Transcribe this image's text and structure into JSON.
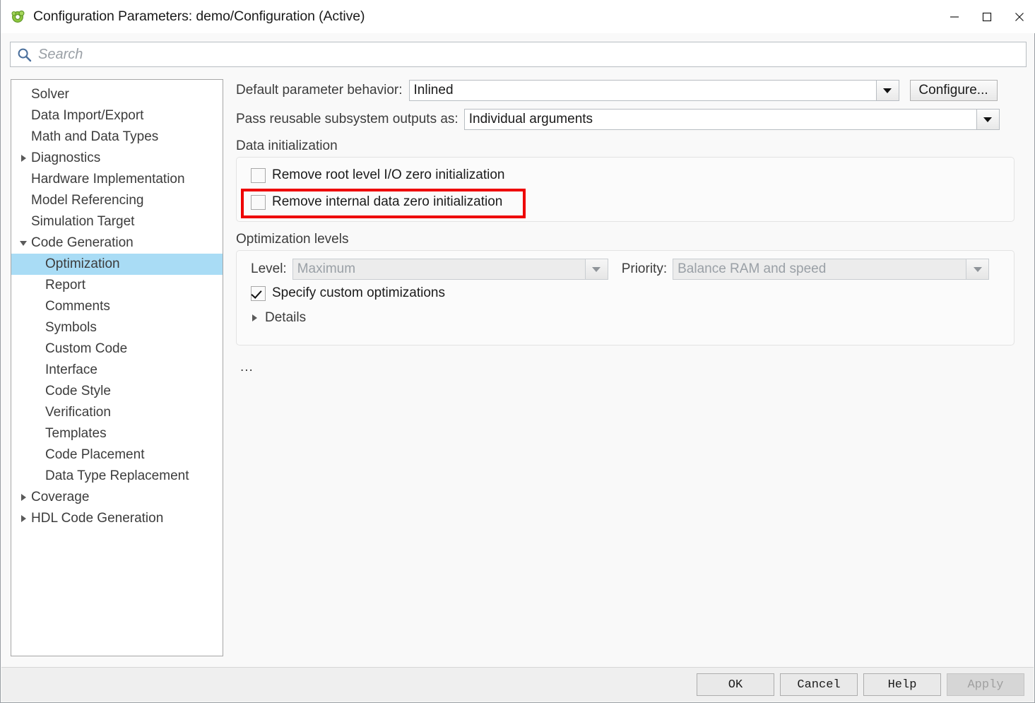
{
  "window": {
    "title": "Configuration Parameters: demo/Configuration (Active)",
    "app_icon": "simulink-gear-icon",
    "minimize_label": "–",
    "maximize_label": "□",
    "close_label": "✕"
  },
  "search": {
    "placeholder": "Search",
    "value": "",
    "icon": "search-icon"
  },
  "sidebar": {
    "items": [
      {
        "label": "Solver",
        "level": 0,
        "twisty": "none",
        "selected": false
      },
      {
        "label": "Data Import/Export",
        "level": 0,
        "twisty": "none",
        "selected": false
      },
      {
        "label": "Math and Data Types",
        "level": 0,
        "twisty": "none",
        "selected": false
      },
      {
        "label": "Diagnostics",
        "level": 0,
        "twisty": "collapsed",
        "selected": false
      },
      {
        "label": "Hardware Implementation",
        "level": 0,
        "twisty": "none",
        "selected": false
      },
      {
        "label": "Model Referencing",
        "level": 0,
        "twisty": "none",
        "selected": false
      },
      {
        "label": "Simulation Target",
        "level": 0,
        "twisty": "none",
        "selected": false
      },
      {
        "label": "Code Generation",
        "level": 0,
        "twisty": "expanded",
        "selected": false
      },
      {
        "label": "Optimization",
        "level": 1,
        "twisty": "none",
        "selected": true
      },
      {
        "label": "Report",
        "level": 1,
        "twisty": "none",
        "selected": false
      },
      {
        "label": "Comments",
        "level": 1,
        "twisty": "none",
        "selected": false
      },
      {
        "label": "Symbols",
        "level": 1,
        "twisty": "none",
        "selected": false
      },
      {
        "label": "Custom Code",
        "level": 1,
        "twisty": "none",
        "selected": false
      },
      {
        "label": "Interface",
        "level": 1,
        "twisty": "none",
        "selected": false
      },
      {
        "label": "Code Style",
        "level": 1,
        "twisty": "none",
        "selected": false
      },
      {
        "label": "Verification",
        "level": 1,
        "twisty": "none",
        "selected": false
      },
      {
        "label": "Templates",
        "level": 1,
        "twisty": "none",
        "selected": false
      },
      {
        "label": "Code Placement",
        "level": 1,
        "twisty": "none",
        "selected": false
      },
      {
        "label": "Data Type Replacement",
        "level": 1,
        "twisty": "none",
        "selected": false
      },
      {
        "label": "Coverage",
        "level": 0,
        "twisty": "collapsed",
        "selected": false
      },
      {
        "label": "HDL Code Generation",
        "level": 0,
        "twisty": "collapsed",
        "selected": false
      }
    ]
  },
  "main": {
    "default_param": {
      "label": "Default parameter behavior:",
      "value": "Inlined",
      "configure_label": "Configure..."
    },
    "pass_reusable": {
      "label": "Pass reusable subsystem outputs as:",
      "value": "Individual arguments"
    },
    "data_init": {
      "title": "Data initialization",
      "checkboxes": [
        {
          "label": "Remove root level I/O zero initialization",
          "checked": false,
          "highlighted": false
        },
        {
          "label": "Remove internal data zero initialization",
          "checked": false,
          "highlighted": true
        }
      ]
    },
    "optimization_levels": {
      "title": "Optimization levels",
      "level_label": "Level:",
      "level_value": "Maximum",
      "level_disabled": true,
      "priority_label": "Priority:",
      "priority_value": "Balance RAM and speed",
      "priority_disabled": true,
      "specify_custom": {
        "label": "Specify custom optimizations",
        "checked": true
      },
      "details_label": "Details",
      "details_expanded": false
    },
    "ellipsis": "..."
  },
  "footer": {
    "buttons": [
      {
        "label": "OK",
        "disabled": false
      },
      {
        "label": "Cancel",
        "disabled": false
      },
      {
        "label": "Help",
        "disabled": false
      },
      {
        "label": "Apply",
        "disabled": true
      }
    ]
  },
  "colors": {
    "selection": "#a9dcf5",
    "highlight": "#ee0000",
    "window_bg": "#f9f9f9"
  }
}
